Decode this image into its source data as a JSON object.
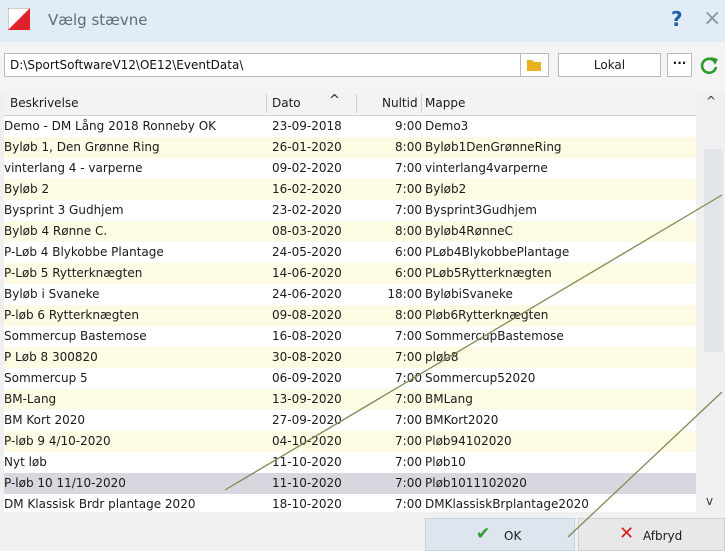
{
  "window": {
    "title": "Vælg stævne",
    "help_label": "?",
    "close_label": "×",
    "accent": "#e0202a"
  },
  "path": {
    "value": "D:\\SportSoftwareV12\\OE12\\EventData\\",
    "lokal_label": "Lokal",
    "more_label": "···"
  },
  "table": {
    "headers": {
      "beskrivelse": "Beskrivelse",
      "dato": "Dato",
      "sort_indicator": "^",
      "nultid": "Nultid",
      "mappe": "Mappe"
    },
    "rows": [
      {
        "beskrivelse": "Demo - DM Lång 2018 Ronneby OK",
        "dato": "23-09-2018",
        "nultid": "9:00",
        "mappe": "Demo3"
      },
      {
        "beskrivelse": "Byløb 1, Den Grønne Ring",
        "dato": "26-01-2020",
        "nultid": "8:00",
        "mappe": "Byløb1DenGrønneRing"
      },
      {
        "beskrivelse": "vinterlang 4 - varperne",
        "dato": "09-02-2020",
        "nultid": "7:00",
        "mappe": "vinterlang4varperne"
      },
      {
        "beskrivelse": "Byløb 2",
        "dato": "16-02-2020",
        "nultid": "7:00",
        "mappe": "Byløb2"
      },
      {
        "beskrivelse": "Bysprint 3 Gudhjem",
        "dato": "23-02-2020",
        "nultid": "7:00",
        "mappe": "Bysprint3Gudhjem"
      },
      {
        "beskrivelse": "Byløb 4 Rønne C.",
        "dato": "08-03-2020",
        "nultid": "8:00",
        "mappe": "Byløb4RønneC"
      },
      {
        "beskrivelse": "P-Løb 4 Blykobbe Plantage",
        "dato": "24-05-2020",
        "nultid": "6:00",
        "mappe": "PLøb4BlykobbePlantage"
      },
      {
        "beskrivelse": "P-Løb 5 Rytterknægten",
        "dato": "14-06-2020",
        "nultid": "6:00",
        "mappe": "PLøb5Rytterknægten"
      },
      {
        "beskrivelse": "Byløb i Svaneke",
        "dato": "24-06-2020",
        "nultid": "18:00",
        "mappe": "ByløbiSvaneke"
      },
      {
        "beskrivelse": "P-løb 6 Rytterknægten",
        "dato": "09-08-2020",
        "nultid": "8:00",
        "mappe": "Pløb6Rytterknægten"
      },
      {
        "beskrivelse": "Sommercup Bastemose",
        "dato": "16-08-2020",
        "nultid": "7:00",
        "mappe": "SommercupBastemose"
      },
      {
        "beskrivelse": "P Løb 8 300820",
        "dato": "30-08-2020",
        "nultid": "7:00",
        "mappe": "pløb8"
      },
      {
        "beskrivelse": "Sommercup 5",
        "dato": "06-09-2020",
        "nultid": "7:00",
        "mappe": "Sommercup52020"
      },
      {
        "beskrivelse": "BM-Lang",
        "dato": "13-09-2020",
        "nultid": "7:00",
        "mappe": "BMLang"
      },
      {
        "beskrivelse": "BM Kort 2020",
        "dato": "27-09-2020",
        "nultid": "7:00",
        "mappe": "BMKort2020"
      },
      {
        "beskrivelse": "P-løb 9 4/10-2020",
        "dato": "04-10-2020",
        "nultid": "7:00",
        "mappe": "Pløb94102020"
      },
      {
        "beskrivelse": "Nyt løb",
        "dato": "11-10-2020",
        "nultid": "7:00",
        "mappe": "Pløb10"
      },
      {
        "beskrivelse": "P-løb 10 11/10-2020",
        "dato": "11-10-2020",
        "nultid": "7:00",
        "mappe": "Pløb1011102020"
      },
      {
        "beskrivelse": "DM Klassisk Brdr plantage 2020",
        "dato": "18-10-2020",
        "nultid": "7:00",
        "mappe": "DMKlassiskBrplantage2020"
      }
    ],
    "selected_index": 17,
    "alt_row_color": "#fdfbe3",
    "selected_color": "#d7d7df"
  },
  "scrollbar": {
    "up_label": "^",
    "down_label": "v"
  },
  "buttons": {
    "ok_label": "OK",
    "cancel_label": "Afbryd",
    "ok_check": "✔",
    "cancel_x": "✕"
  }
}
